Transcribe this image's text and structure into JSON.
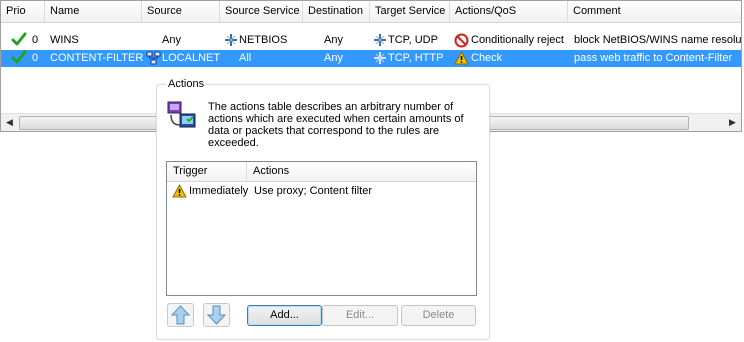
{
  "columns": [
    "Prio",
    "Name",
    "Source",
    "Source Service",
    "Destination",
    "Target Service",
    "Actions/QoS",
    "Comment"
  ],
  "rows": [
    {
      "prio": "0",
      "name": "WINS",
      "source": "Any",
      "source_service": "NETBIOS",
      "destination": "Any",
      "target_service": "TCP, UDP",
      "action": "Conditionally reject",
      "action_icon": "reject-icon",
      "comment": "block NetBIOS/WINS name resolu"
    },
    {
      "prio": "0",
      "name": "CONTENT-FILTER",
      "source": "LOCALNET",
      "source_service": "All",
      "destination": "Any",
      "target_service": "TCP, HTTP",
      "action": "Check",
      "action_icon": "warning-icon",
      "comment": "pass web traffic to Content-Filter"
    }
  ],
  "actions_group": {
    "title": "Actions",
    "description": "The actions table describes an arbitrary number of actions which are executed when certain amounts of data or packets that correspond to the rules are exceeded.",
    "columns": [
      "Trigger",
      "Actions"
    ],
    "rows": [
      {
        "trigger": "Immediately",
        "actions": "Use proxy; Content filter"
      }
    ],
    "buttons": {
      "add": "Add...",
      "edit": "Edit...",
      "delete": "Delete"
    }
  },
  "colors": {
    "selection": "#3399ff",
    "check": "#21a321",
    "reject": "#d92020",
    "warning": "#f2c200"
  }
}
